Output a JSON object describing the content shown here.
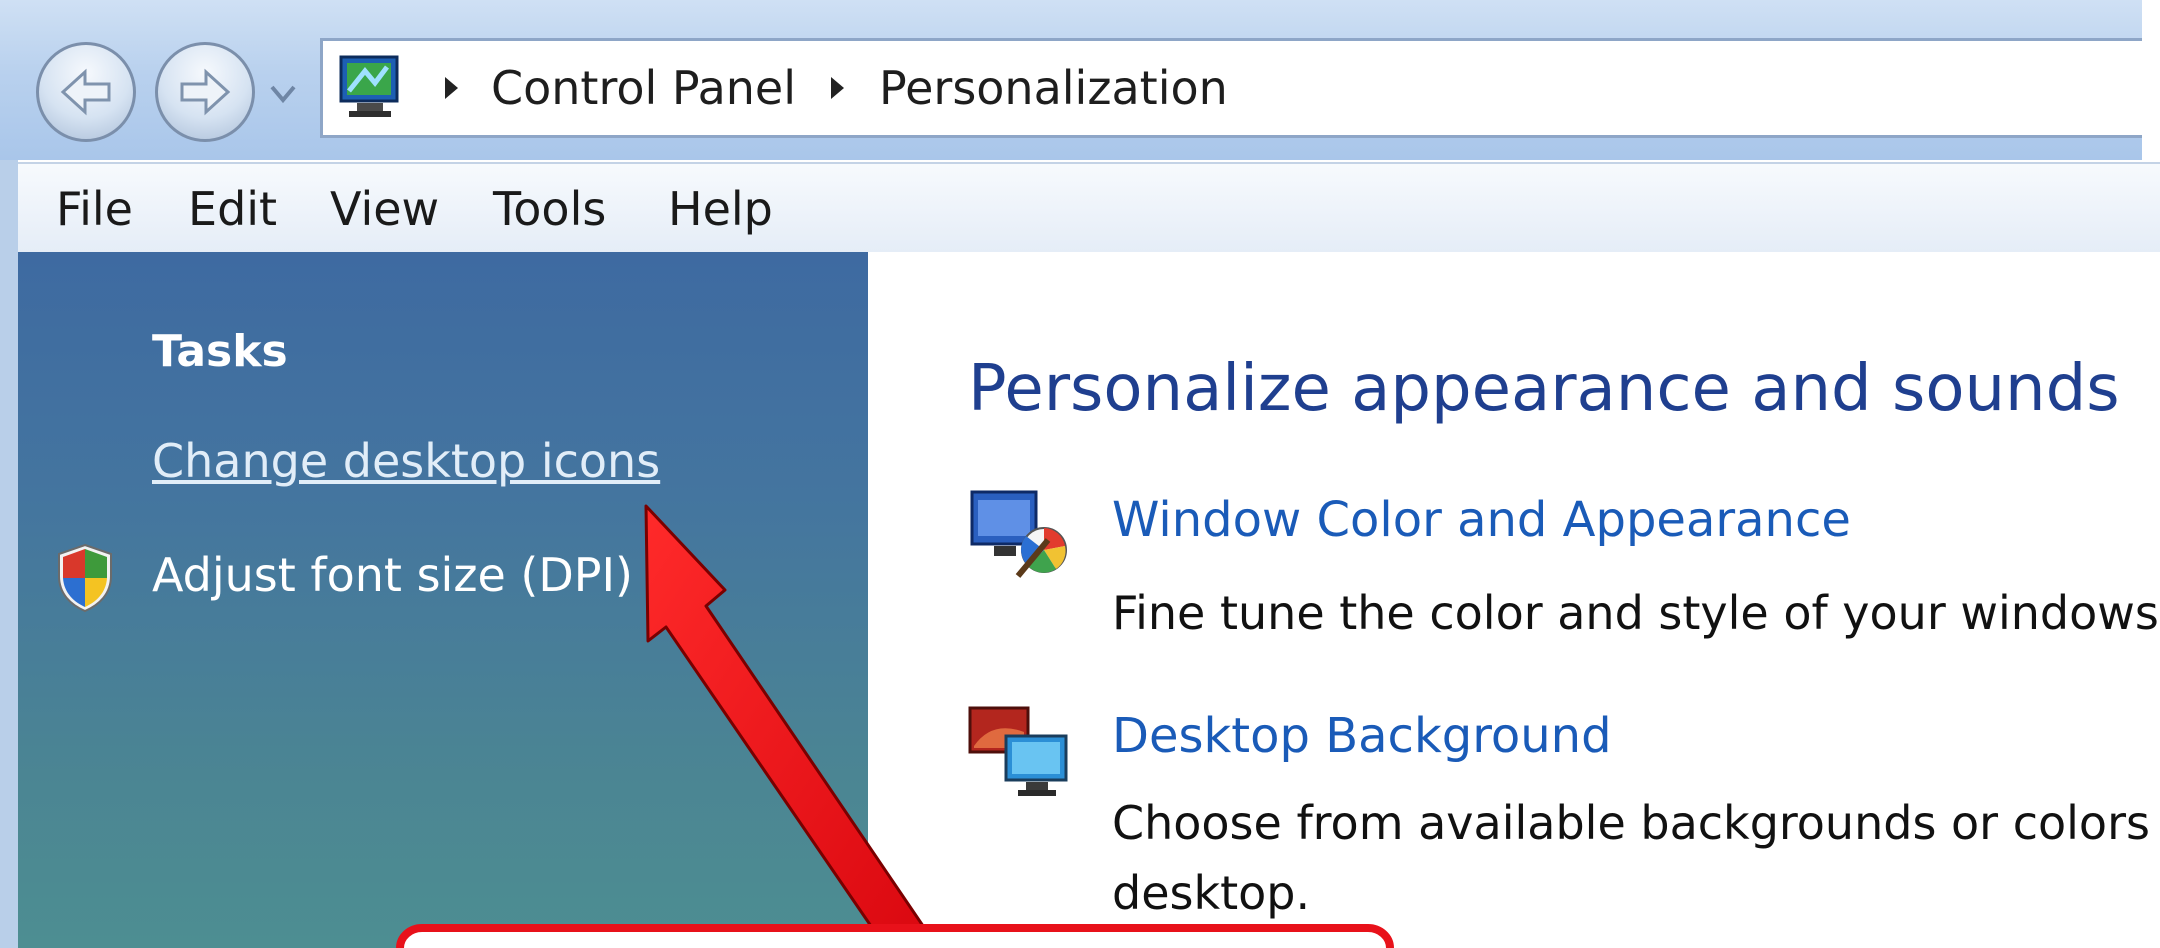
{
  "breadcrumb": {
    "items": [
      "Control Panel",
      "Personalization"
    ]
  },
  "menu": {
    "items": [
      "File",
      "Edit",
      "View",
      "Tools",
      "Help"
    ]
  },
  "tasks": {
    "heading": "Tasks",
    "change_desktop_icons": "Change desktop icons",
    "adjust_font_size": "Adjust font size (DPI)"
  },
  "main": {
    "title": "Personalize appearance and sounds",
    "items": [
      {
        "link": "Window Color and Appearance",
        "description": "Fine tune the color and style of your windows."
      },
      {
        "link": "Desktop Background",
        "description": "Choose from available backgrounds or colors o",
        "description_line2": "desktop."
      }
    ]
  },
  "icons": {
    "back": "back-arrow-icon",
    "forward": "forward-arrow-icon",
    "address": "control-panel-icon",
    "shield": "uac-shield-icon",
    "window_color": "window-color-icon",
    "desktop_background": "desktop-background-icon"
  },
  "colors": {
    "annotation": "#e8111a",
    "link": "#1a5bb8",
    "title": "#1f3f8f"
  }
}
